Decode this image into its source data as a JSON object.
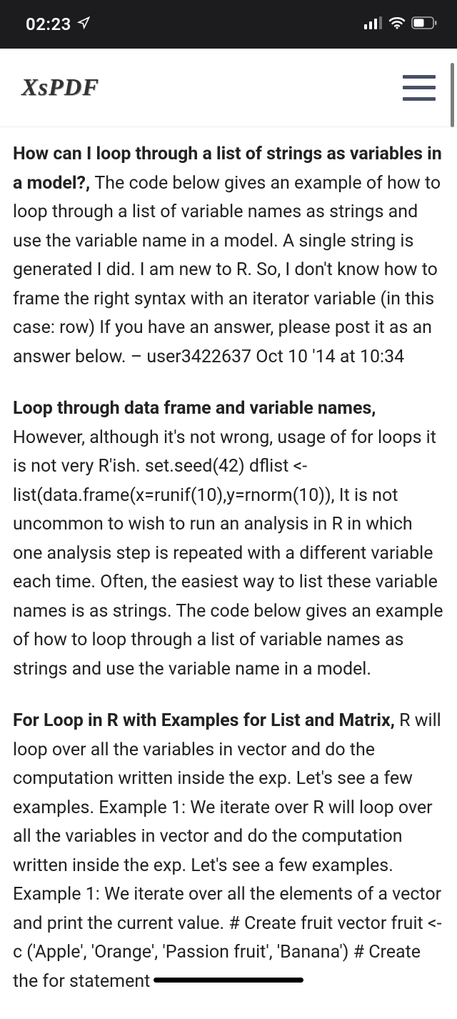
{
  "status": {
    "time": "02:23"
  },
  "nav": {
    "logo": "XsPDF"
  },
  "paragraphs": [
    {
      "bold": "How can I loop through a list of strings as variables in a model?, ",
      "text": "The code below gives an example of how to loop through a list of variable names as strings and use the variable name in a model. A single string is generated  I did. I am new to R. So, I don't know how to frame the right syntax with an iterator variable (in this case: row) If you have an answer, please post it as an answer below. – user3422637 Oct 10 '14 at 10:34"
    },
    {
      "bold": "Loop through data frame and variable names, ",
      "text": "However, although it's not wrong, usage of for loops it is not very R'ish. set.seed(42) dflist <- list(data.frame(x=runif(10),y=rnorm(10)),  It is not uncommon to wish to run an analysis in R in which one analysis step is repeated with a different variable each time. Often, the easiest way to list these variable names is as strings. The code below gives an example of how to loop through a list of variable names as strings and use the variable name in a model."
    },
    {
      "bold": "For Loop in R with Examples for List and Matrix, ",
      "text": "R will loop over all the variables in vector and do the computation written inside the exp. Let's see a few examples. Example 1: We iterate over  R will loop over all the variables in vector and do the computation written inside the exp. Let's see a few examples. Example 1: We iterate over all the elements of a vector and print the current value. # Create fruit vector fruit <- c ('Apple', 'Orange', 'Passion fruit', 'Banana') # Create the for statement"
    }
  ]
}
